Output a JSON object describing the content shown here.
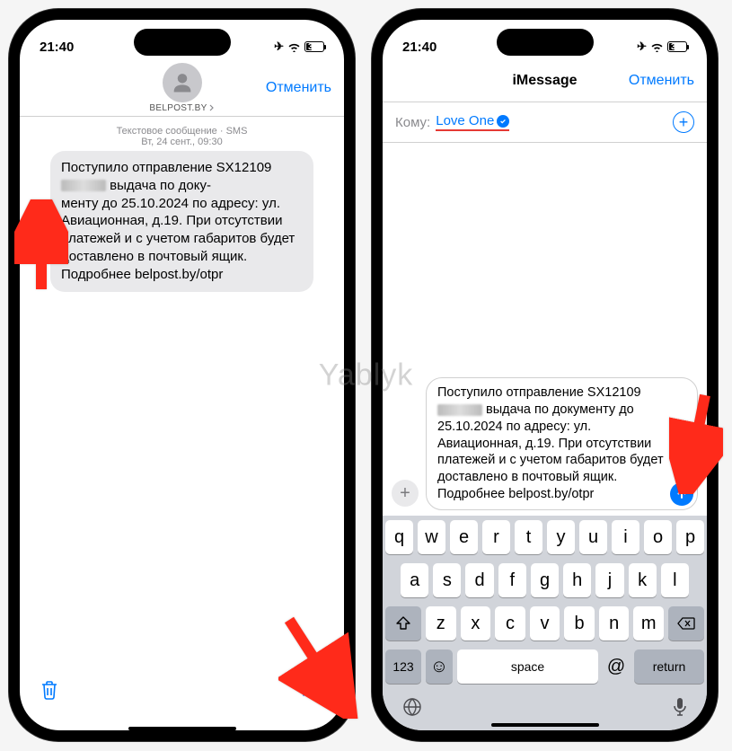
{
  "status": {
    "time": "21:40",
    "battery": "36"
  },
  "left": {
    "sender": "BELPOST.BY",
    "cancel": "Отменить",
    "meta_type": "Текстовое сообщение · SMS",
    "meta_date": "Вт, 24 сент., 09:30",
    "msg_p1": "Поступило отправление SX12109",
    "msg_p2": " выдача по доку-\nменту до 25.10.2024 по адресу: ул. Авиационная, д.19. При отсутствии платежей и с учетом габаритов будет доставлено в почтовый ящик. Подробнее belpost.by/otpr"
  },
  "right": {
    "title": "iMessage",
    "cancel": "Отменить",
    "to_label": "Кому:",
    "recipient": "Love One",
    "compose_p1": "Поступило отправление SX12109",
    "compose_p2": " выдача по документу до 25.10.2024 по адресу: ул. Авиационная, д.19. При отсутствии платежей и с учетом габаритов будет доставлено в почтовый ящик. Подробнее belpost.by/otpr"
  },
  "keyboard": {
    "r1": [
      "q",
      "w",
      "e",
      "r",
      "t",
      "y",
      "u",
      "i",
      "o",
      "p"
    ],
    "r2": [
      "a",
      "s",
      "d",
      "f",
      "g",
      "h",
      "j",
      "k",
      "l"
    ],
    "r3": [
      "z",
      "x",
      "c",
      "v",
      "b",
      "n",
      "m"
    ],
    "num": "123",
    "space": "space",
    "ret": "return"
  },
  "watermark": "Yablyk"
}
